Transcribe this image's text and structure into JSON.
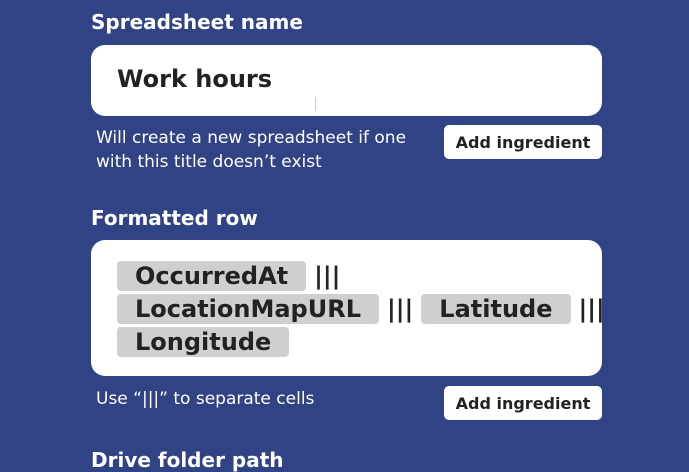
{
  "spreadsheet_section": {
    "title": "Spreadsheet name",
    "value": "Work hours",
    "helper": "Will create a new spreadsheet if one with this title doesn’t exist",
    "add_button": "Add ingredient"
  },
  "row_section": {
    "title": "Formatted row",
    "tokens": [
      "OccurredAt",
      "LocationMapURL",
      "Latitude",
      "Longitude"
    ],
    "separator": "|||",
    "helper": "Use “|||” to separate cells",
    "add_button": "Add ingredient"
  },
  "next_section": {
    "title": "Drive folder path"
  }
}
